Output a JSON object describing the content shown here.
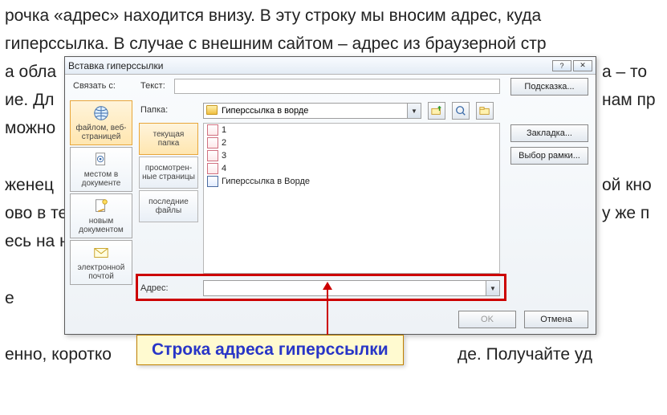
{
  "bg": {
    "l1": "рочка «адрес» находится внизу. В эту строку мы вносим адрес, куда",
    "l2": "гиперссылка. В случае с внешним сайтом – адрес из браузерной стр",
    "l3a": "а обла",
    "l3b": "а – то",
    "l4a": "ие. Дл",
    "l4b": "нам пр",
    "l5": "можно",
    "l6": "женец",
    "l6b": "ой кно",
    "l7": "ово в те",
    "l7b": "у же п",
    "l8": "есь на н",
    "l9": "е",
    "l10a": "енно, коротко",
    "l10b": "де. Получайте уд"
  },
  "dialog": {
    "title": "Вставка гиперссылки",
    "close": "✕",
    "help": "?",
    "link_to_label": "Связать с:",
    "text_label": "Текст:",
    "screentip_btn": "Подсказка...",
    "folder_label": "Папка:",
    "folder_value": "Гиперссылка в ворде",
    "bookmark_btn": "Закладка...",
    "targetframe_btn": "Выбор рамки...",
    "address_label": "Адрес:",
    "ok_btn": "OK",
    "cancel_btn": "Отмена",
    "left_tabs": {
      "t1": "файлом, веб-страницей",
      "t2": "местом в документе",
      "t3": "новым документом",
      "t4": "электронной почтой"
    },
    "mid_tabs": {
      "m1": "текущая папка",
      "m2": "просмотрен-ные страницы",
      "m3": "последние файлы"
    },
    "files": {
      "f1": "1",
      "f2": "2",
      "f3": "3",
      "f4": "4",
      "f5": "Гиперссылка в Ворде"
    }
  },
  "callout": "Строка адреса гиперссылки"
}
